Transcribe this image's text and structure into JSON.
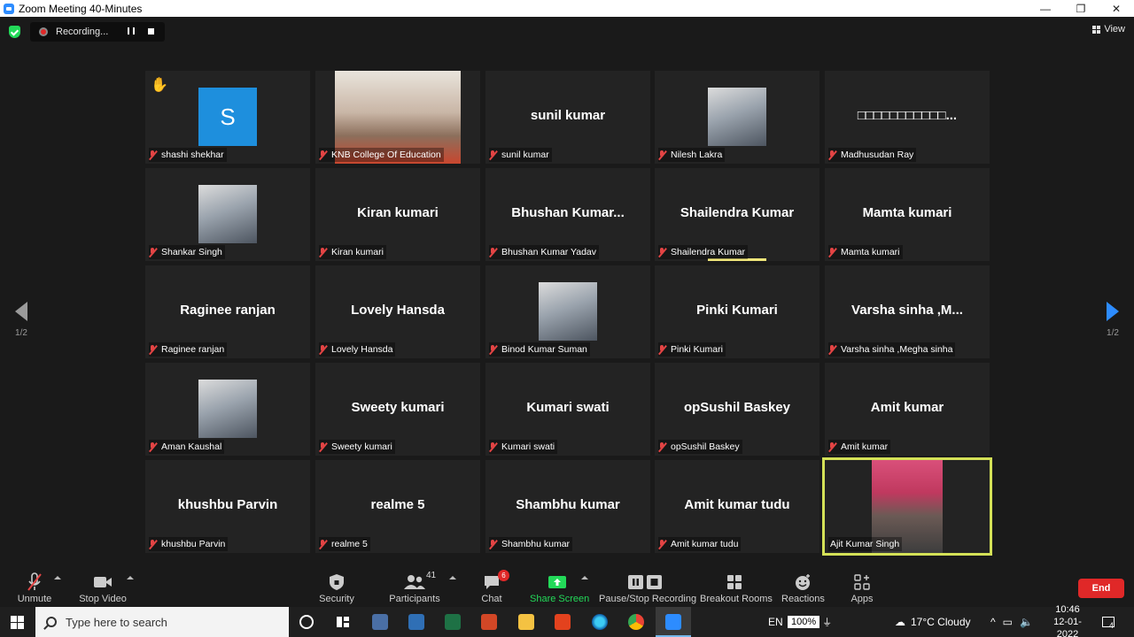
{
  "window": {
    "title": "Zoom Meeting 40-Minutes",
    "minimize": "—",
    "maximize": "❐",
    "close": "✕"
  },
  "recording": {
    "label": "Recording..."
  },
  "view": {
    "label": "View"
  },
  "pagination": {
    "left_page": "1/2",
    "right_page": "1/2"
  },
  "tiles": [
    {
      "label": "shashi shekhar",
      "center": "",
      "avatar_letter": "S",
      "kind": "avatar",
      "hand_raised": true
    },
    {
      "label": "KNB College Of Education",
      "center": "",
      "kind": "video"
    },
    {
      "label": "sunil kumar",
      "center": "sunil kumar",
      "kind": "name"
    },
    {
      "label": "Nilesh Lakra",
      "center": "",
      "kind": "photo"
    },
    {
      "label": "Madhusudan Ray",
      "center": "□□□□□□□□□□□...",
      "kind": "name"
    },
    {
      "label": "Shankar Singh",
      "center": "",
      "kind": "photo"
    },
    {
      "label": "Kiran kumari",
      "center": "Kiran kumari",
      "kind": "name"
    },
    {
      "label": "Bhushan Kumar Yadav",
      "center": "Bhushan  Kumar...",
      "kind": "name"
    },
    {
      "label": "Shailendra Kumar",
      "center": "Shailendra Kumar",
      "kind": "name",
      "speaking": true
    },
    {
      "label": "Mamta kumari",
      "center": "Mamta kumari",
      "kind": "name"
    },
    {
      "label": "Raginee ranjan",
      "center": "Raginee ranjan",
      "kind": "name"
    },
    {
      "label": "Lovely Hansda",
      "center": "Lovely Hansda",
      "kind": "name"
    },
    {
      "label": "Binod Kumar Suman",
      "center": "",
      "kind": "photo"
    },
    {
      "label": "Pinki Kumari",
      "center": "Pinki Kumari",
      "kind": "name"
    },
    {
      "label": "Varsha sinha ,Megha sinha",
      "center": "Varsha  sinha  ,M...",
      "kind": "name"
    },
    {
      "label": "Aman Kaushal",
      "center": "",
      "kind": "photo"
    },
    {
      "label": "Sweety kumari",
      "center": "Sweety kumari",
      "kind": "name"
    },
    {
      "label": "Kumari swati",
      "center": "Kumari swati",
      "kind": "name"
    },
    {
      "label": "opSushil Baskey",
      "center": "opSushil Baskey",
      "kind": "name"
    },
    {
      "label": "Amit kumar",
      "center": "Amit kumar",
      "kind": "name"
    },
    {
      "label": "khushbu Parvin",
      "center": "khushbu Parvin",
      "kind": "name"
    },
    {
      "label": "realme 5",
      "center": "realme 5",
      "kind": "name"
    },
    {
      "label": "Shambhu kumar",
      "center": "Shambhu kumar",
      "kind": "name"
    },
    {
      "label": "Amit kumar tudu",
      "center": "Amit kumar tudu",
      "kind": "name"
    },
    {
      "label": "Ajit Kumar Singh",
      "center": "",
      "kind": "video",
      "active_speaker": true,
      "unmuted": true
    }
  ],
  "toolbar": {
    "unmute": "Unmute",
    "stop_video": "Stop Video",
    "security": "Security",
    "participants": "Participants",
    "participants_count": "41",
    "chat": "Chat",
    "chat_badge": "6",
    "share_screen": "Share Screen",
    "pause_stop_recording": "Pause/Stop Recording",
    "breakout_rooms": "Breakout Rooms",
    "reactions": "Reactions",
    "apps": "Apps",
    "end": "End"
  },
  "taskbar": {
    "search_placeholder": "Type here to search",
    "language": "EN",
    "battery": "100%",
    "weather": "17°C  Cloudy",
    "time": "10:46",
    "date": "12-01-2022",
    "notifications": "4"
  },
  "colors": {
    "accent_blue": "#2d8cff",
    "end_red": "#e02828",
    "share_green": "#23d959",
    "active_speaker": "#d4e157",
    "tile_bg": "#232323"
  }
}
